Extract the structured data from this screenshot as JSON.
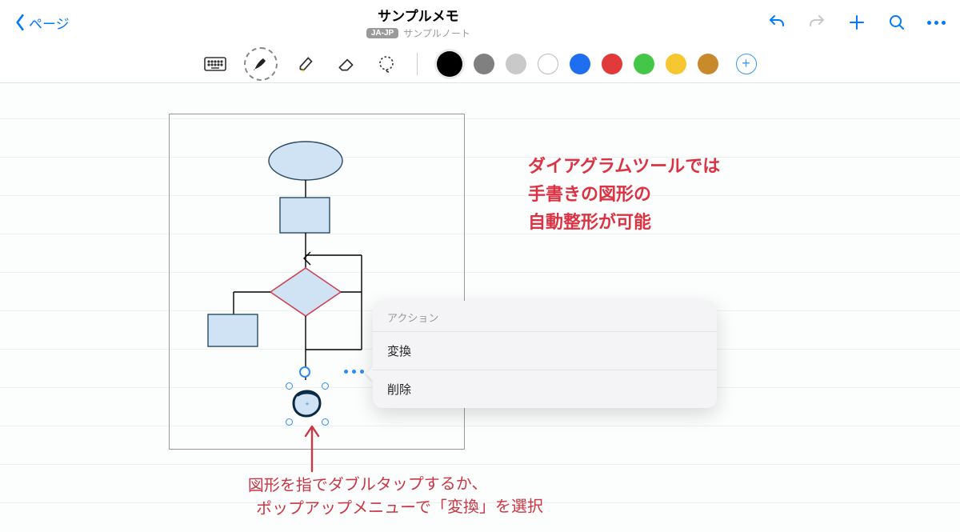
{
  "header": {
    "back_label": "ページ",
    "title": "サンプルメモ",
    "lang_badge": "JA-JP",
    "notebook": "サンプルノート"
  },
  "tools": {
    "keyboard": "keyboard-icon",
    "pen": "pen-icon",
    "highlighter": "highlighter-icon",
    "eraser": "eraser-icon",
    "lasso": "lasso-icon"
  },
  "colors": [
    {
      "name": "black",
      "hex": "#000000",
      "selected": true
    },
    {
      "name": "gray",
      "hex": "#808080"
    },
    {
      "name": "silver",
      "hex": "#c9c9c9"
    },
    {
      "name": "white",
      "hex": "#ffffff",
      "outline": true
    },
    {
      "name": "blue",
      "hex": "#1e6ff0"
    },
    {
      "name": "red",
      "hex": "#e03a3a"
    },
    {
      "name": "green",
      "hex": "#44c648"
    },
    {
      "name": "yellow",
      "hex": "#f7c731"
    },
    {
      "name": "ochre",
      "hex": "#c98a2c"
    }
  ],
  "annotation": {
    "red_text": "ダイアグラムツールでは\n手書きの図形の\n自動整形が可能",
    "hand_note": "図形を指でダブルタップするか、\n  ポップアップメニューで「変換」を選択"
  },
  "popup": {
    "header": "アクション",
    "items": [
      "変換",
      "削除"
    ]
  },
  "selection": {
    "plus_hint": "+"
  }
}
